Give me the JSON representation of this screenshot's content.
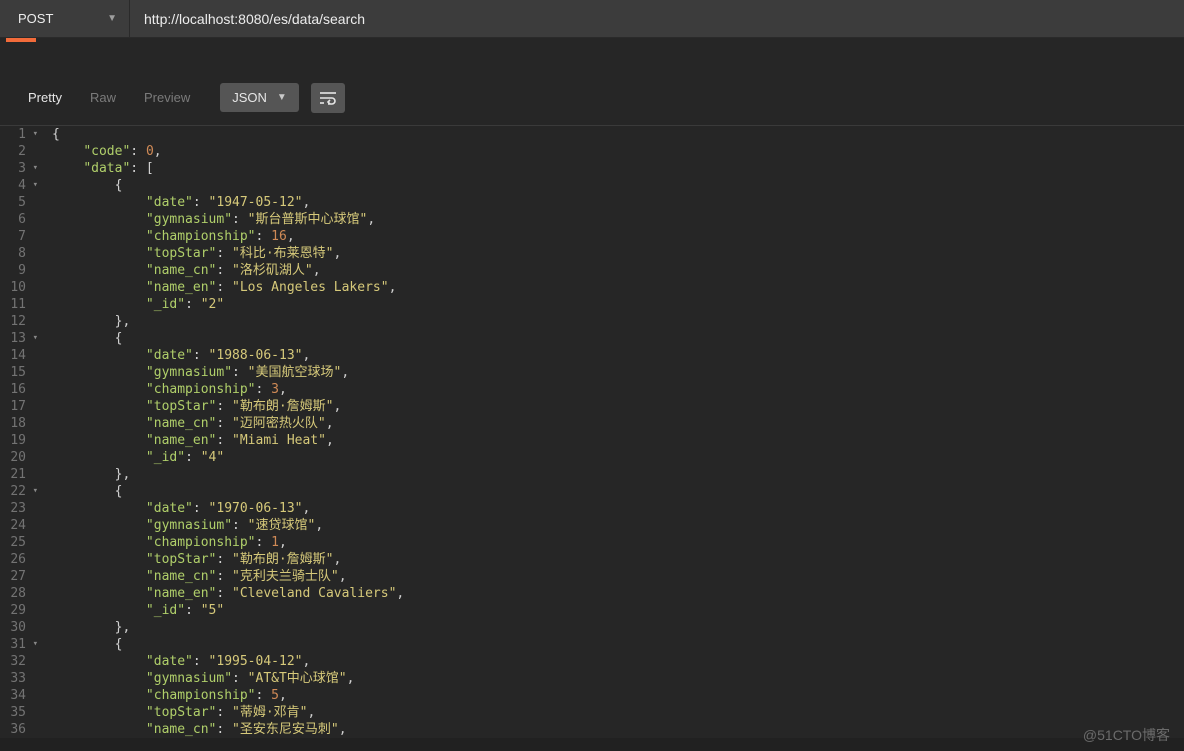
{
  "request": {
    "method": "POST",
    "url": "http://localhost:8080/es/data/search"
  },
  "response_view": {
    "tabs": {
      "pretty": "Pretty",
      "raw": "Raw",
      "preview": "Preview"
    },
    "active_tab": "pretty",
    "format": "JSON"
  },
  "code_lines": [
    {
      "n": 1,
      "fold": "▾",
      "indent": 0,
      "tokens": [
        {
          "t": "p",
          "v": "{"
        }
      ]
    },
    {
      "n": 2,
      "fold": "",
      "indent": 1,
      "tokens": [
        {
          "t": "k",
          "v": "\"code\""
        },
        {
          "t": "p",
          "v": ": "
        },
        {
          "t": "n",
          "v": "0"
        },
        {
          "t": "p",
          "v": ","
        }
      ]
    },
    {
      "n": 3,
      "fold": "▾",
      "indent": 1,
      "tokens": [
        {
          "t": "k",
          "v": "\"data\""
        },
        {
          "t": "p",
          "v": ": ["
        }
      ]
    },
    {
      "n": 4,
      "fold": "▾",
      "indent": 2,
      "tokens": [
        {
          "t": "p",
          "v": "{"
        }
      ]
    },
    {
      "n": 5,
      "fold": "",
      "indent": 3,
      "tokens": [
        {
          "t": "k",
          "v": "\"date\""
        },
        {
          "t": "p",
          "v": ": "
        },
        {
          "t": "s",
          "v": "\"1947-05-12\""
        },
        {
          "t": "p",
          "v": ","
        }
      ]
    },
    {
      "n": 6,
      "fold": "",
      "indent": 3,
      "tokens": [
        {
          "t": "k",
          "v": "\"gymnasium\""
        },
        {
          "t": "p",
          "v": ": "
        },
        {
          "t": "s",
          "v": "\"斯台普斯中心球馆\""
        },
        {
          "t": "p",
          "v": ","
        }
      ]
    },
    {
      "n": 7,
      "fold": "",
      "indent": 3,
      "tokens": [
        {
          "t": "k",
          "v": "\"championship\""
        },
        {
          "t": "p",
          "v": ": "
        },
        {
          "t": "n",
          "v": "16"
        },
        {
          "t": "p",
          "v": ","
        }
      ]
    },
    {
      "n": 8,
      "fold": "",
      "indent": 3,
      "tokens": [
        {
          "t": "k",
          "v": "\"topStar\""
        },
        {
          "t": "p",
          "v": ": "
        },
        {
          "t": "s",
          "v": "\"科比·布莱恩特\""
        },
        {
          "t": "p",
          "v": ","
        }
      ]
    },
    {
      "n": 9,
      "fold": "",
      "indent": 3,
      "tokens": [
        {
          "t": "k",
          "v": "\"name_cn\""
        },
        {
          "t": "p",
          "v": ": "
        },
        {
          "t": "s",
          "v": "\"洛杉矶湖人\""
        },
        {
          "t": "p",
          "v": ","
        }
      ]
    },
    {
      "n": 10,
      "fold": "",
      "indent": 3,
      "tokens": [
        {
          "t": "k",
          "v": "\"name_en\""
        },
        {
          "t": "p",
          "v": ": "
        },
        {
          "t": "s",
          "v": "\"Los Angeles Lakers\""
        },
        {
          "t": "p",
          "v": ","
        }
      ]
    },
    {
      "n": 11,
      "fold": "",
      "indent": 3,
      "tokens": [
        {
          "t": "k",
          "v": "\"_id\""
        },
        {
          "t": "p",
          "v": ": "
        },
        {
          "t": "s",
          "v": "\"2\""
        }
      ]
    },
    {
      "n": 12,
      "fold": "",
      "indent": 2,
      "tokens": [
        {
          "t": "p",
          "v": "},"
        }
      ]
    },
    {
      "n": 13,
      "fold": "▾",
      "indent": 2,
      "tokens": [
        {
          "t": "p",
          "v": "{"
        }
      ]
    },
    {
      "n": 14,
      "fold": "",
      "indent": 3,
      "tokens": [
        {
          "t": "k",
          "v": "\"date\""
        },
        {
          "t": "p",
          "v": ": "
        },
        {
          "t": "s",
          "v": "\"1988-06-13\""
        },
        {
          "t": "p",
          "v": ","
        }
      ]
    },
    {
      "n": 15,
      "fold": "",
      "indent": 3,
      "tokens": [
        {
          "t": "k",
          "v": "\"gymnasium\""
        },
        {
          "t": "p",
          "v": ": "
        },
        {
          "t": "s",
          "v": "\"美国航空球场\""
        },
        {
          "t": "p",
          "v": ","
        }
      ]
    },
    {
      "n": 16,
      "fold": "",
      "indent": 3,
      "tokens": [
        {
          "t": "k",
          "v": "\"championship\""
        },
        {
          "t": "p",
          "v": ": "
        },
        {
          "t": "n",
          "v": "3"
        },
        {
          "t": "p",
          "v": ","
        }
      ]
    },
    {
      "n": 17,
      "fold": "",
      "indent": 3,
      "tokens": [
        {
          "t": "k",
          "v": "\"topStar\""
        },
        {
          "t": "p",
          "v": ": "
        },
        {
          "t": "s",
          "v": "\"勒布朗·詹姆斯\""
        },
        {
          "t": "p",
          "v": ","
        }
      ]
    },
    {
      "n": 18,
      "fold": "",
      "indent": 3,
      "tokens": [
        {
          "t": "k",
          "v": "\"name_cn\""
        },
        {
          "t": "p",
          "v": ": "
        },
        {
          "t": "s",
          "v": "\"迈阿密热火队\""
        },
        {
          "t": "p",
          "v": ","
        }
      ]
    },
    {
      "n": 19,
      "fold": "",
      "indent": 3,
      "tokens": [
        {
          "t": "k",
          "v": "\"name_en\""
        },
        {
          "t": "p",
          "v": ": "
        },
        {
          "t": "s",
          "v": "\"Miami Heat\""
        },
        {
          "t": "p",
          "v": ","
        }
      ]
    },
    {
      "n": 20,
      "fold": "",
      "indent": 3,
      "tokens": [
        {
          "t": "k",
          "v": "\"_id\""
        },
        {
          "t": "p",
          "v": ": "
        },
        {
          "t": "s",
          "v": "\"4\""
        }
      ]
    },
    {
      "n": 21,
      "fold": "",
      "indent": 2,
      "tokens": [
        {
          "t": "p",
          "v": "},"
        }
      ]
    },
    {
      "n": 22,
      "fold": "▾",
      "indent": 2,
      "tokens": [
        {
          "t": "p",
          "v": "{"
        }
      ]
    },
    {
      "n": 23,
      "fold": "",
      "indent": 3,
      "tokens": [
        {
          "t": "k",
          "v": "\"date\""
        },
        {
          "t": "p",
          "v": ": "
        },
        {
          "t": "s",
          "v": "\"1970-06-13\""
        },
        {
          "t": "p",
          "v": ","
        }
      ]
    },
    {
      "n": 24,
      "fold": "",
      "indent": 3,
      "tokens": [
        {
          "t": "k",
          "v": "\"gymnasium\""
        },
        {
          "t": "p",
          "v": ": "
        },
        {
          "t": "s",
          "v": "\"速贷球馆\""
        },
        {
          "t": "p",
          "v": ","
        }
      ]
    },
    {
      "n": 25,
      "fold": "",
      "indent": 3,
      "tokens": [
        {
          "t": "k",
          "v": "\"championship\""
        },
        {
          "t": "p",
          "v": ": "
        },
        {
          "t": "n",
          "v": "1"
        },
        {
          "t": "p",
          "v": ","
        }
      ]
    },
    {
      "n": 26,
      "fold": "",
      "indent": 3,
      "tokens": [
        {
          "t": "k",
          "v": "\"topStar\""
        },
        {
          "t": "p",
          "v": ": "
        },
        {
          "t": "s",
          "v": "\"勒布朗·詹姆斯\""
        },
        {
          "t": "p",
          "v": ","
        }
      ]
    },
    {
      "n": 27,
      "fold": "",
      "indent": 3,
      "tokens": [
        {
          "t": "k",
          "v": "\"name_cn\""
        },
        {
          "t": "p",
          "v": ": "
        },
        {
          "t": "s",
          "v": "\"克利夫兰骑士队\""
        },
        {
          "t": "p",
          "v": ","
        }
      ]
    },
    {
      "n": 28,
      "fold": "",
      "indent": 3,
      "tokens": [
        {
          "t": "k",
          "v": "\"name_en\""
        },
        {
          "t": "p",
          "v": ": "
        },
        {
          "t": "s",
          "v": "\"Cleveland Cavaliers\""
        },
        {
          "t": "p",
          "v": ","
        }
      ]
    },
    {
      "n": 29,
      "fold": "",
      "indent": 3,
      "tokens": [
        {
          "t": "k",
          "v": "\"_id\""
        },
        {
          "t": "p",
          "v": ": "
        },
        {
          "t": "s",
          "v": "\"5\""
        }
      ]
    },
    {
      "n": 30,
      "fold": "",
      "indent": 2,
      "tokens": [
        {
          "t": "p",
          "v": "},"
        }
      ]
    },
    {
      "n": 31,
      "fold": "▾",
      "indent": 2,
      "tokens": [
        {
          "t": "p",
          "v": "{"
        }
      ]
    },
    {
      "n": 32,
      "fold": "",
      "indent": 3,
      "tokens": [
        {
          "t": "k",
          "v": "\"date\""
        },
        {
          "t": "p",
          "v": ": "
        },
        {
          "t": "s",
          "v": "\"1995-04-12\""
        },
        {
          "t": "p",
          "v": ","
        }
      ]
    },
    {
      "n": 33,
      "fold": "",
      "indent": 3,
      "tokens": [
        {
          "t": "k",
          "v": "\"gymnasium\""
        },
        {
          "t": "p",
          "v": ": "
        },
        {
          "t": "s",
          "v": "\"AT&T中心球馆\""
        },
        {
          "t": "p",
          "v": ","
        }
      ]
    },
    {
      "n": 34,
      "fold": "",
      "indent": 3,
      "tokens": [
        {
          "t": "k",
          "v": "\"championship\""
        },
        {
          "t": "p",
          "v": ": "
        },
        {
          "t": "n",
          "v": "5"
        },
        {
          "t": "p",
          "v": ","
        }
      ]
    },
    {
      "n": 35,
      "fold": "",
      "indent": 3,
      "tokens": [
        {
          "t": "k",
          "v": "\"topStar\""
        },
        {
          "t": "p",
          "v": ": "
        },
        {
          "t": "s",
          "v": "\"蒂姆·邓肯\""
        },
        {
          "t": "p",
          "v": ","
        }
      ]
    },
    {
      "n": 36,
      "fold": "",
      "indent": 3,
      "tokens": [
        {
          "t": "k",
          "v": "\"name_cn\""
        },
        {
          "t": "p",
          "v": ": "
        },
        {
          "t": "s",
          "v": "\"圣安东尼安马刺\""
        },
        {
          "t": "p",
          "v": ","
        }
      ]
    }
  ],
  "watermark": "@51CTO博客"
}
